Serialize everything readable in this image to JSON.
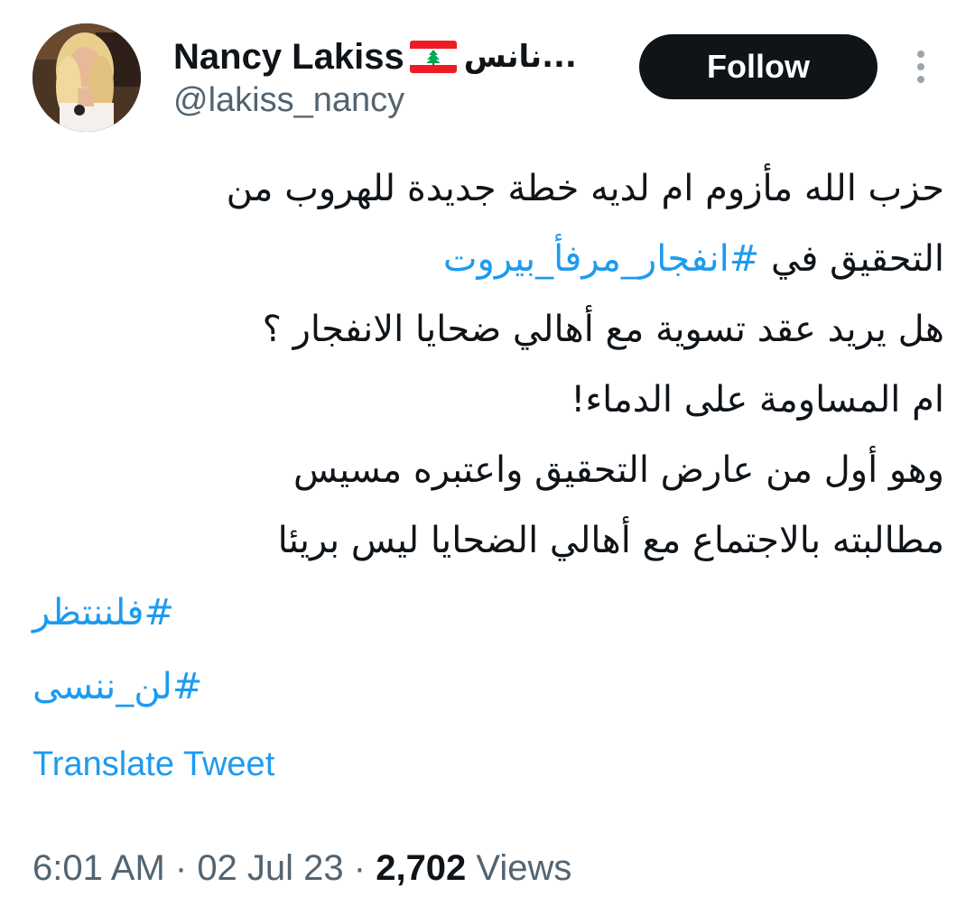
{
  "author": {
    "name": "Nancy Lakiss",
    "name_suffix": "...نانس",
    "handle": "@lakiss_nancy",
    "flag_icon": "lebanon-flag-icon"
  },
  "actions": {
    "follow_label": "Follow",
    "more_icon": "more-vertical-icon"
  },
  "tweet": {
    "line1": "حزب الله مأزوم ام لديه خطة جديدة للهروب من",
    "line2_prefix": "التحقيق في ",
    "line2_hashtag": "#انفجار_مرفأ_بيروت",
    "line3": "هل يريد عقد تسوية مع أهالي ضحايا الانفجار ؟",
    "line4": "ام  المساومة على الدماء!",
    "line5": "وهو أول من عارض التحقيق واعتبره مسيس",
    "line6": "مطالبته بالاجتماع مع أهالي الضحايا ليس بريئا",
    "hashtag1": "#فلننتظر",
    "hashtag2": "#لن_ننسى"
  },
  "translate_label": "Translate Tweet",
  "meta": {
    "time": "6:01 AM",
    "separator": " · ",
    "date": "02 Jul 23",
    "views_count": "2,702",
    "views_label": " Views"
  },
  "colors": {
    "link": "#1d9bf0",
    "text": "#0f1419",
    "secondary": "#536471",
    "follow_bg": "#0f1419"
  }
}
